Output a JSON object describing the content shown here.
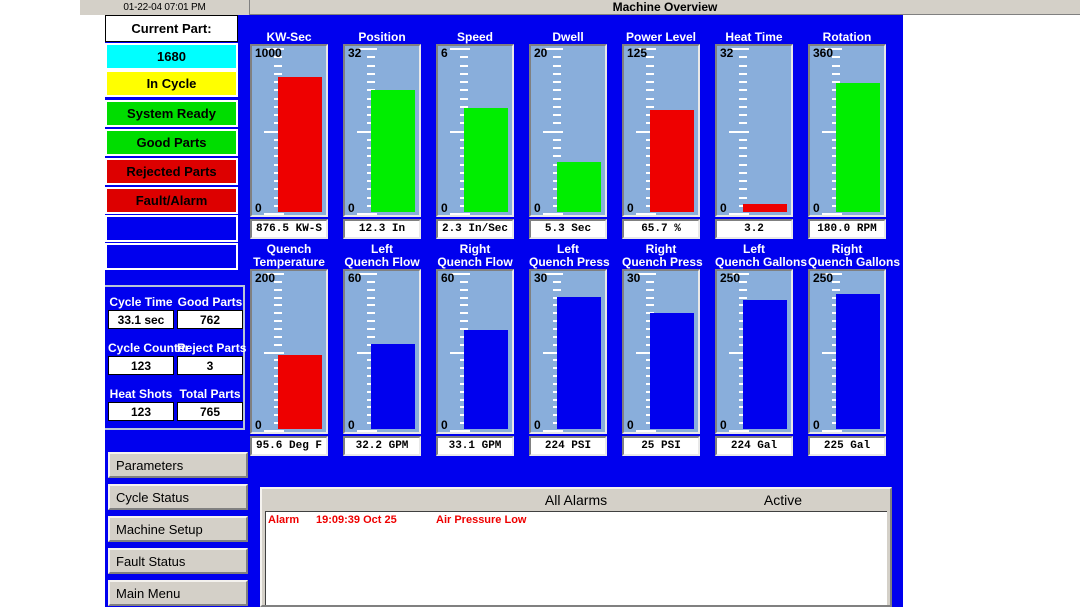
{
  "titlebar": {
    "clock": "01-22-04  07:01 PM",
    "title": "Machine Overview"
  },
  "left_panel": {
    "status_boxes": [
      {
        "label": "Current Part:",
        "style": "white"
      },
      {
        "label": "1680",
        "style": "cyan"
      },
      {
        "label": "In Cycle",
        "style": "yellow"
      },
      {
        "label": "System Ready",
        "style": "green"
      },
      {
        "label": "Good Parts",
        "style": "green"
      },
      {
        "label": "Rejected Parts",
        "style": "red"
      },
      {
        "label": "Fault/Alarm",
        "style": "red"
      },
      {
        "label": "",
        "style": "blank"
      },
      {
        "label": "",
        "style": "blank"
      }
    ],
    "counters": [
      {
        "label": "Cycle Time",
        "value": "33.1 sec"
      },
      {
        "label": "Good Parts",
        "value": "762"
      },
      {
        "label": "Cycle Counter",
        "value": "123"
      },
      {
        "label": "Reject Parts",
        "value": "3"
      },
      {
        "label": "Heat Shots",
        "value": "123"
      },
      {
        "label": "Total Parts",
        "value": "765"
      }
    ],
    "menu_buttons": [
      "Parameters",
      "Cycle Status",
      "Machine Setup",
      "Fault Status",
      "Main Menu"
    ]
  },
  "gauges_row1": [
    {
      "title": "KW-Sec",
      "title2": "",
      "max": "1000",
      "min": "0",
      "value": 876.5,
      "max_num": 1000,
      "readout": "876.5 KW-S",
      "color": "red"
    },
    {
      "title": "Position",
      "title2": "",
      "max": "32",
      "min": "0",
      "value": 12.3,
      "max_num": 32,
      "readout": "12.3 In",
      "color": "green"
    },
    {
      "title": "Speed",
      "title2": "",
      "max": "6",
      "min": "0",
      "value": 2.3,
      "max_num": 6,
      "readout": "2.3 In/Sec",
      "color": "green"
    },
    {
      "title": "Dwell",
      "title2": "",
      "max": "20",
      "min": "0",
      "value": 5.3,
      "max_num": 20,
      "readout": "5.3 Sec",
      "color": "green"
    },
    {
      "title": "Power Level",
      "title2": "",
      "max": "125",
      "min": "0",
      "value": 65.7,
      "max_num": 125,
      "readout": "65.7 %",
      "color": "red"
    },
    {
      "title": "Heat Time",
      "title2": "",
      "max": "32",
      "min": "0",
      "value": 3.2,
      "max_num": 32,
      "readout": "3.2",
      "color": "red"
    },
    {
      "title": "Rotation",
      "title2": "",
      "max": "360",
      "min": "0",
      "value": 180.0,
      "max_num": 360,
      "readout": "180.0 RPM",
      "color": "green"
    }
  ],
  "gauges_row2": [
    {
      "title": "Quench",
      "title2": "Temperature",
      "max": "200",
      "min": "0",
      "value": 95.6,
      "max_num": 200,
      "readout": "95.6 Deg F",
      "color": "red"
    },
    {
      "title": "Left",
      "title2": "Quench Flow",
      "max": "60",
      "min": "0",
      "value": 32.2,
      "max_num": 60,
      "readout": "32.2 GPM",
      "color": "blue"
    },
    {
      "title": "Right",
      "title2": "Quench Flow",
      "max": "60",
      "min": "0",
      "value": 33.1,
      "max_num": 60,
      "readout": "33.1 GPM",
      "color": "blue"
    },
    {
      "title": "Left",
      "title2": "Quench Press",
      "max": "30",
      "min": "0",
      "value": 224,
      "max_num": 30,
      "readout": "224 PSI",
      "color": "blue"
    },
    {
      "title": "Right",
      "title2": "Quench Press",
      "max": "30",
      "min": "0",
      "value": 25,
      "max_num": 30,
      "readout": "25 PSI",
      "color": "blue"
    },
    {
      "title": "Left",
      "title2": "Quench Gallons",
      "max": "250",
      "min": "0",
      "value": 224,
      "max_num": 250,
      "readout": "224 Gal",
      "color": "blue"
    },
    {
      "title": "Right",
      "title2": "Quench Gallons",
      "max": "250",
      "min": "0",
      "value": 225,
      "max_num": 250,
      "readout": "225 Gal",
      "color": "blue"
    }
  ],
  "gauge_bar_heights_row1": [
    0.82,
    0.74,
    0.63,
    0.3,
    0.62,
    0.05,
    0.78
  ],
  "gauge_bar_heights_row2": [
    0.47,
    0.54,
    0.63,
    0.84,
    0.74,
    0.82,
    0.86
  ],
  "alarm_panel": {
    "header_all": "All Alarms",
    "header_active": "Active",
    "rows": [
      {
        "kind": "Alarm",
        "time": "19:09:39 Oct 25",
        "message": "Air Pressure Low"
      }
    ]
  },
  "colors": {
    "background_blue": "#0000ee",
    "gauge_face": "#89aedb",
    "fill_red": "#ee0000",
    "fill_green": "#00ee00",
    "fill_blue": "#0000ee",
    "chrome": "#d4d0c8",
    "alarm_text": "#ee0000"
  }
}
